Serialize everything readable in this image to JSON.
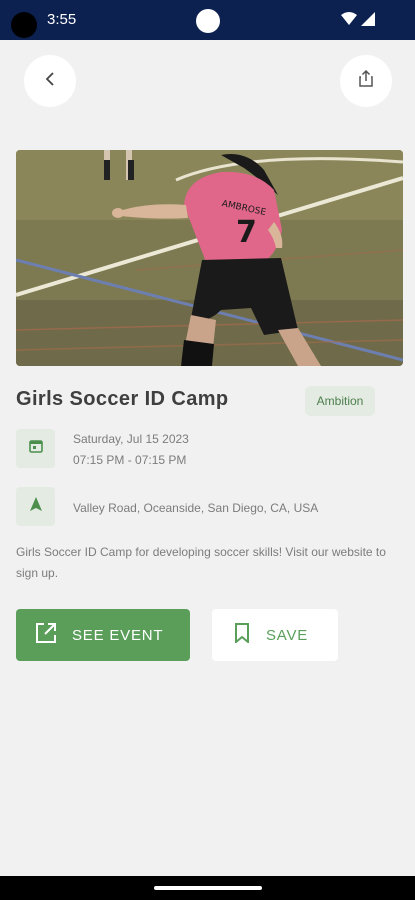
{
  "status_bar": {
    "time": "3:55"
  },
  "event": {
    "title": "Girls Soccer ID Camp",
    "tag": "Ambition",
    "date": "Saturday, Jul 15 2023",
    "time": "07:15 PM - 07:15 PM",
    "location": "Valley Road, Oceanside, San Diego, CA, USA",
    "description": "Girls Soccer ID Camp for developing soccer skills! Visit our website to sign up.",
    "jersey_number": "7",
    "jersey_name": "AMBROSE"
  },
  "actions": {
    "see_event_label": "SEE EVENT",
    "save_label": "SAVE"
  },
  "icons": {
    "back": "chevron-left-icon",
    "share": "share-icon",
    "date": "calendar-icon",
    "location": "navigation-arrow-icon",
    "see_event": "open-in-new-icon",
    "save": "bookmark-icon"
  },
  "colors": {
    "status_bar": "#0d2150",
    "accent_green": "#5a9e5a",
    "tag_bg": "#e3ebe3",
    "background": "#f1f1f1"
  }
}
